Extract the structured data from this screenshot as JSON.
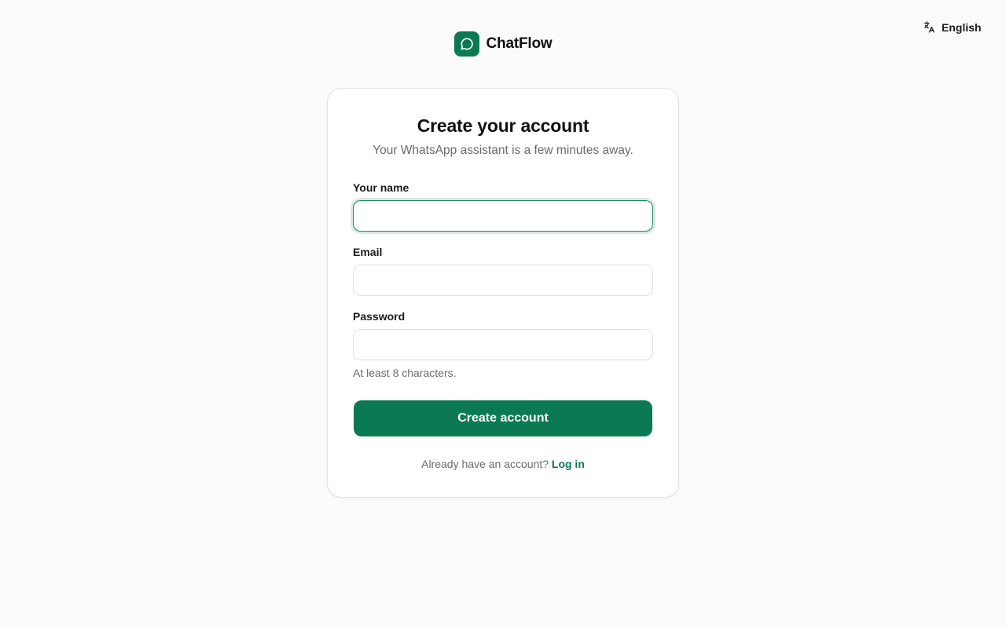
{
  "language_selector": {
    "icon": "translate-icon",
    "label": "English"
  },
  "brand": {
    "icon": "chat-bubble-icon",
    "name": "ChatFlow",
    "accent_color": "#0b7a52"
  },
  "signup_form": {
    "title": "Create your account",
    "subtitle": "Your WhatsApp assistant is a few minutes away.",
    "fields": [
      {
        "label": "Your name",
        "value": "",
        "placeholder": "",
        "focused": true
      },
      {
        "label": "Email",
        "value": "",
        "placeholder": ""
      },
      {
        "label": "Password",
        "value": "",
        "placeholder": "",
        "hint": "At least 8 characters."
      }
    ],
    "submit_label": "Create account",
    "login_prompt": "Already have an account?",
    "login_link": "Log in"
  }
}
